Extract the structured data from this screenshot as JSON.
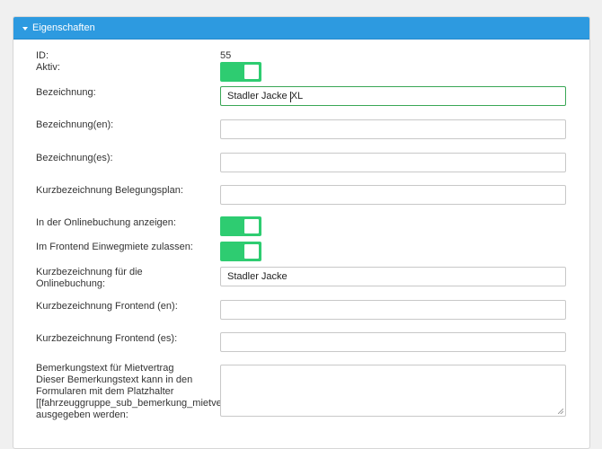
{
  "panel": {
    "title": "Eigenschaften"
  },
  "fields": {
    "id": {
      "label": "ID:",
      "value": "55"
    },
    "aktiv": {
      "label": "Aktiv:",
      "on": true
    },
    "bezeichnung": {
      "label": "Bezeichnung:",
      "value_before_cursor": "Stadler Jacke ",
      "value_after_cursor": "XL"
    },
    "bezeichnung_en": {
      "label": "Bezeichnung(en):",
      "value": ""
    },
    "bezeichnung_es": {
      "label": "Bezeichnung(es):",
      "value": ""
    },
    "kurzbezeichnung_belegungsplan": {
      "label": "Kurzbezeichnung Belegungsplan:",
      "value": ""
    },
    "online_anzeigen": {
      "label": "In der Onlinebuchung anzeigen:",
      "on": true
    },
    "einwegmiete": {
      "label": "Im Frontend Einwegmiete zulassen:",
      "on": true
    },
    "kurzbezeichnung_online": {
      "label_line1": "Kurzbezeichnung für die",
      "label_line2": "Onlinebuchung:",
      "value": "Stadler Jacke"
    },
    "kurzbezeichnung_frontend_en": {
      "label": "Kurzbezeichnung Frontend (en):",
      "value": ""
    },
    "kurzbezeichnung_frontend_es": {
      "label": "Kurzbezeichnung Frontend (es):",
      "value": ""
    },
    "bemerkungstext": {
      "label_line1": "Bemerkungstext für Mietvertrag",
      "label_line2": "Dieser Bemerkungstext kann in den",
      "label_line3": "Formularen mit dem Platzhalter",
      "label_line4": "[[fahrzeuggruppe_sub_bemerkung_mietvertrag]]",
      "label_line5": "ausgegeben werden:",
      "value": ""
    }
  },
  "colors": {
    "header": "#2d9ae0",
    "toggle_on": "#2ecc71",
    "focus_border": "#3aa756"
  }
}
